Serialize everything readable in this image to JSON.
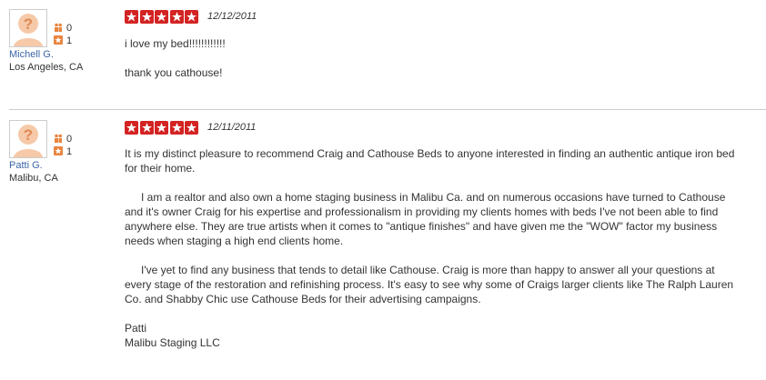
{
  "colors": {
    "star": "#d32323",
    "name_link": "#3b65a7",
    "separator": "#cccccc"
  },
  "reviews": [
    {
      "user": {
        "name": "Michell G.",
        "location": "Los Angeles, CA",
        "friends": "0",
        "reviews": "1"
      },
      "rating": 5,
      "date": "12/12/2011",
      "paragraphs": [
        "i love my bed!!!!!!!!!!!!",
        "thank you cathouse!"
      ]
    },
    {
      "user": {
        "name": "Patti G.",
        "location": "Malibu, CA",
        "friends": "0",
        "reviews": "1"
      },
      "rating": 5,
      "date": "12/11/2011",
      "paragraphs": [
        "It is my distinct pleasure to recommend Craig and Cathouse Beds to anyone interested in finding an authentic antique iron bed for their home.",
        "I am a realtor and also own a home staging business in Malibu Ca. and on numerous occasions have turned to Cathouse and it's owner Craig for his expertise and professionalism in providing my clients homes with beds I've not been able to find anywhere else. They are true artists when it comes to \"antique finishes\" and have given me the \"WOW\" factor my business needs when staging a high end clients home.",
        "I've yet to find any business that tends to detail like Cathouse. Craig is more than happy to answer all your questions at every stage of the restoration and refinishing process. It's easy to see why some of Craigs larger clients like The Ralph Lauren Co. and Shabby Chic  use Cathouse Beds for their advertising campaigns.",
        "Patti",
        "Malibu Staging LLC"
      ]
    }
  ]
}
